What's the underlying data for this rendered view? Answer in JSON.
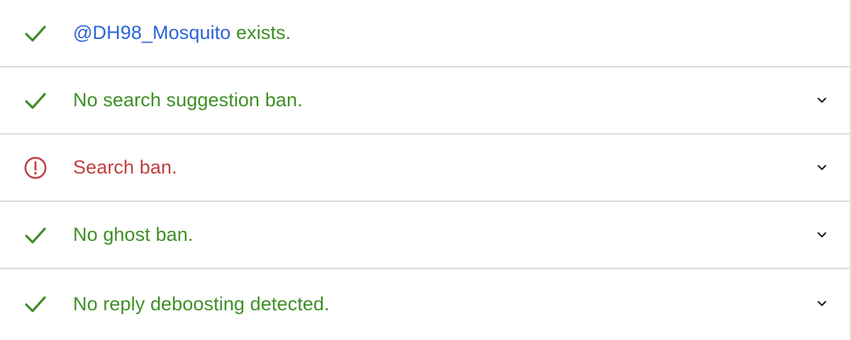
{
  "colors": {
    "ok": "#3e8e25",
    "ban": "#c0403f",
    "handle": "#2a63d8"
  },
  "rows": [
    {
      "status": "ok",
      "icon": "check-icon",
      "handle": "@DH98_Mosquito",
      "text": " exists.",
      "expandable": false
    },
    {
      "status": "ok",
      "icon": "check-icon",
      "text": "No search suggestion ban.",
      "expandable": true
    },
    {
      "status": "ban",
      "icon": "alert-circle-icon",
      "text": "Search ban.",
      "expandable": true
    },
    {
      "status": "ok",
      "icon": "check-icon",
      "text": "No ghost ban.",
      "expandable": true
    },
    {
      "status": "ok",
      "icon": "check-icon",
      "text": "No reply deboosting detected.",
      "expandable": true
    }
  ]
}
